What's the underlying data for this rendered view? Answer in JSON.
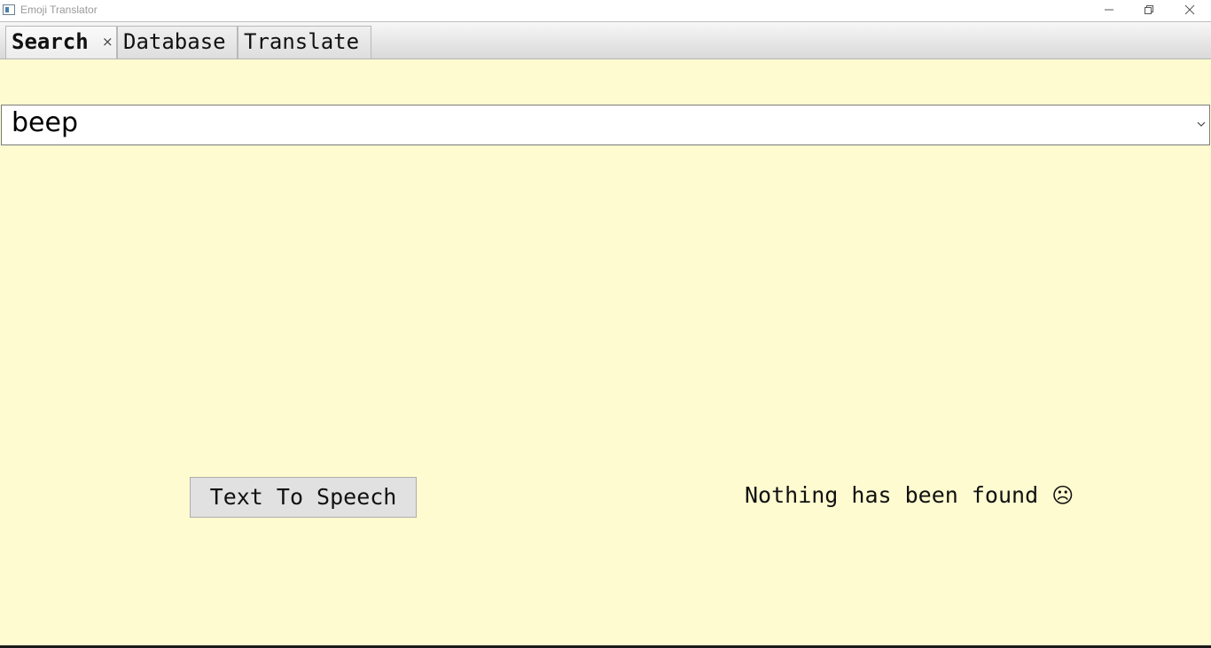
{
  "window": {
    "title": "Emoji Translator"
  },
  "tabs": [
    {
      "label": "Search",
      "close": "×",
      "active": true
    },
    {
      "label": "Database",
      "active": false
    },
    {
      "label": "Translate",
      "active": false
    }
  ],
  "search": {
    "value": "beep"
  },
  "actions": {
    "tts_label": "Text To Speech"
  },
  "status": {
    "message": "Nothing has been found",
    "emoji": "☹"
  },
  "colors": {
    "background": "#fffbd0",
    "button": "#e1e1e1"
  }
}
